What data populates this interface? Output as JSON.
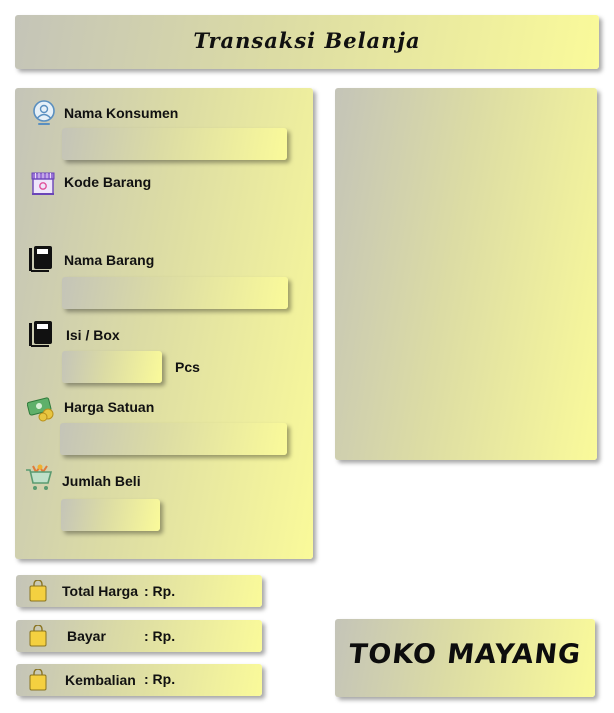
{
  "header": {
    "title": "Transaksi Belanja"
  },
  "form": {
    "nama_konsumen": {
      "label": "Nama Konsumen",
      "value": ""
    },
    "kode_barang": {
      "label": "Kode Barang"
    },
    "nama_barang": {
      "label": "Nama Barang",
      "value": ""
    },
    "isi_box": {
      "label": "Isi / Box",
      "value": "",
      "unit": "Pcs"
    },
    "harga_satuan": {
      "label": "Harga Satuan",
      "value": ""
    },
    "jumlah_beli": {
      "label": "Jumlah Beli",
      "value": ""
    }
  },
  "summary": {
    "total": {
      "label": "Total Harga",
      "prefix": ": Rp."
    },
    "bayar": {
      "label": "Bayar",
      "prefix": ": Rp."
    },
    "kembalian": {
      "label": "Kembalian",
      "prefix": ": Rp."
    }
  },
  "brand": {
    "name": "TOKO MAYANG"
  },
  "icons": {
    "customer": "customer-icon",
    "store": "store-icon",
    "book": "book-icon",
    "money": "money-icon",
    "cart": "cart-icon",
    "bag": "shopping-bag-icon"
  },
  "colors": {
    "gradient_start": "#c4c4b8",
    "gradient_end": "#fafa9a"
  }
}
